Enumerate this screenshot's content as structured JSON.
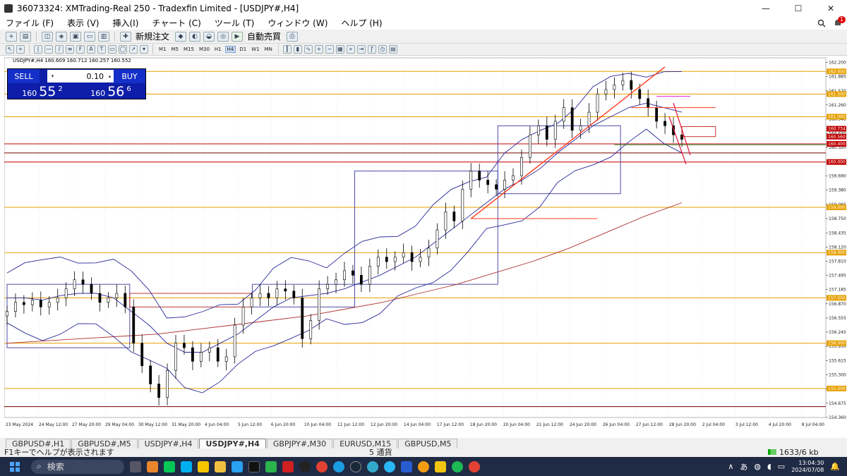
{
  "window": {
    "title": "36073324: XMTrading-Real 250 - Tradexfin Limited - [USDJPY#,H4]",
    "minimize": "—",
    "maximize": "☐",
    "close": "✕"
  },
  "menu": {
    "items": [
      "ファイル (F)",
      "表示 (V)",
      "挿入(I)",
      "チャート (C)",
      "ツール (T)",
      "ウィンドウ (W)",
      "ヘルプ (H)"
    ],
    "notification_count": "1"
  },
  "toolbar1": {
    "new_order": "新規注文",
    "auto_trade": "自動売買"
  },
  "toolbar2": {
    "timeframes": [
      "M1",
      "M5",
      "M15",
      "M30",
      "H1",
      "H4",
      "D1",
      "W1",
      "MN"
    ],
    "active_timeframe": "H4"
  },
  "chart_header": {
    "symbol_info": "USDJPY#,H4  160.609 160.712 160.257 160.552"
  },
  "trade_panel": {
    "sell_label": "SELL",
    "buy_label": "BUY",
    "lot": "0.10",
    "sell_big": "160",
    "sell_mid": "55",
    "sell_small": "2",
    "buy_big": "160",
    "buy_mid": "56",
    "buy_small": "6"
  },
  "chart_data": {
    "type": "candlestick",
    "symbol": "USDJPY#",
    "timeframe": "H4",
    "ylim": [
      154.36,
      162.3
    ],
    "y_ticks": [
      "162.200",
      "161.885",
      "161.570",
      "161.260",
      "160.945",
      "160.630",
      "160.320",
      "159.690",
      "159.380",
      "159.065",
      "158.750",
      "158.435",
      "158.120",
      "157.810",
      "157.495",
      "157.185",
      "156.870",
      "156.555",
      "156.245",
      "155.930",
      "155.615",
      "155.300",
      "154.990",
      "154.675",
      "154.360"
    ],
    "x_ticks": [
      "23 May 2024",
      "24 May 12:00",
      "27 May 20:00",
      "29 May 04:00",
      "30 May 12:00",
      "31 May 20:00",
      "4 Jun 04:00",
      "5 Jun 12:00",
      "6 Jun 20:00",
      "10 Jun 04:00",
      "11 Jun 12:00",
      "12 Jun 20:00",
      "14 Jun 04:00",
      "17 Jun 12:00",
      "18 Jun 20:00",
      "20 Jun 04:00",
      "21 Jun 12:00",
      "24 Jun 20:00",
      "26 Jun 04:00",
      "27 Jun 12:00",
      "28 Jun 20:00",
      "2 Jul 04:00",
      "3 Jul 12:00",
      "4 Jul 20:00",
      "8 Jul 04:00"
    ],
    "price_labels": [
      {
        "value": 162.0,
        "text": "162.000",
        "color": "#e6a000"
      },
      {
        "value": 161.5,
        "text": "161.500",
        "color": "#e6a000"
      },
      {
        "value": 161.0,
        "text": "161.000",
        "color": "#e6a000"
      },
      {
        "value": 160.734,
        "text": "160.734",
        "color": "#c00000"
      },
      {
        "value": 160.56,
        "text": "160.560",
        "color": "#c00000"
      },
      {
        "value": 160.4,
        "text": "160.400",
        "color": "#c00000"
      },
      {
        "value": 160.0,
        "text": "160.000",
        "color": "#c00000"
      },
      {
        "value": 159.0,
        "text": "159.000",
        "color": "#e6a000"
      },
      {
        "value": 158.0,
        "text": "158.000",
        "color": "#e6a000"
      },
      {
        "value": 157.0,
        "text": "157.000",
        "color": "#e6a000"
      },
      {
        "value": 156.0,
        "text": "156.000",
        "color": "#e6a000"
      },
      {
        "value": 155.0,
        "text": "155.000",
        "color": "#e6a000"
      }
    ],
    "horizontal_levels": [
      {
        "value": 162.0,
        "color": "#e6a000"
      },
      {
        "value": 161.5,
        "color": "#e6a000"
      },
      {
        "value": 161.0,
        "color": "#e6a000"
      },
      {
        "value": 160.4,
        "color": "#c00000"
      },
      {
        "value": 160.2,
        "color": "#7a0000"
      },
      {
        "value": 160.0,
        "color": "#c00000"
      },
      {
        "value": 159.0,
        "color": "#e6a000"
      },
      {
        "value": 158.0,
        "color": "#e6a000"
      },
      {
        "value": 157.0,
        "color": "#e6a000"
      },
      {
        "value": 156.0,
        "color": "#e6a000"
      },
      {
        "value": 155.0,
        "color": "#e6a000"
      },
      {
        "value": 154.6,
        "color": "#7a0000"
      }
    ],
    "close_path": [
      156.7,
      156.9,
      156.85,
      156.95,
      156.8,
      156.9,
      157.0,
      157.2,
      157.4,
      157.3,
      157.1,
      156.9,
      157.0,
      157.1,
      156.8,
      156.0,
      155.5,
      155.1,
      154.8,
      155.4,
      156.0,
      155.9,
      155.6,
      155.8,
      155.9,
      155.6,
      155.7,
      156.4,
      156.8,
      157.0,
      157.1,
      157.0,
      157.2,
      157.15,
      157.0,
      156.1,
      156.5,
      157.2,
      157.3,
      157.4,
      157.6,
      157.5,
      157.3,
      157.7,
      157.9,
      157.8,
      157.9,
      158.0,
      157.8,
      157.9,
      158.1,
      158.5,
      158.9,
      158.7,
      159.4,
      159.8,
      159.6,
      159.5,
      159.4,
      159.6,
      159.7,
      160.1,
      160.6,
      160.8,
      160.5,
      160.9,
      161.2,
      160.7,
      160.8,
      161.1,
      161.5,
      161.6,
      161.7,
      161.8,
      161.6,
      161.4,
      161.2,
      160.9,
      160.8,
      160.6,
      160.5
    ],
    "bollinger_center": [
      157.0,
      157.0,
      156.95,
      157.05,
      157.1,
      157.1,
      157.0,
      156.7,
      156.4,
      156.0,
      155.8,
      155.8,
      156.0,
      156.2,
      156.5,
      156.8,
      157.0,
      157.05,
      157.1,
      157.2,
      157.35,
      157.5,
      157.7,
      157.9,
      158.2,
      158.5,
      158.8,
      159.1,
      159.4,
      159.6,
      159.85,
      160.2,
      160.5,
      160.8,
      161.0,
      161.2,
      161.3,
      161.2,
      161.1
    ],
    "ma_long": [
      156.0,
      156.05,
      156.1,
      156.15,
      156.2,
      156.3,
      156.4,
      156.5,
      156.6,
      156.75,
      156.9,
      157.1,
      157.3,
      157.55,
      157.8,
      158.1,
      158.45,
      158.8,
      159.1
    ],
    "range_boxes": [
      {
        "from_index": 0,
        "to_index": 6,
        "low": 155.9,
        "high": 157.3,
        "color": "#3a3aa0"
      },
      {
        "from_index": 6,
        "to_index": 12,
        "low": 156.8,
        "high": 157.1,
        "color": "#b22222"
      },
      {
        "from_index": 12,
        "to_index": 17,
        "low": 156.8,
        "high": 157.3,
        "color": "#3a3aa0"
      },
      {
        "from_index": 17,
        "to_index": 24,
        "low": 157.3,
        "high": 159.8,
        "color": "#3a3aa0"
      },
      {
        "from_index": 24,
        "to_index": 30,
        "low": 159.3,
        "high": 160.8,
        "color": "#3a3aa0"
      }
    ]
  },
  "tabs": {
    "items": [
      "GBPUSD#,H1",
      "GBPUSD#,M5",
      "USDJPY#,H4",
      "USDJPY#,H4",
      "GBPJPY#,M30",
      "EURUSD,M15",
      "GBPUSD,M5"
    ],
    "active_index": 3
  },
  "status": {
    "help": "F1キーでヘルプが表示されます",
    "mid": "5 通貨",
    "traffic": "1633/6 kb"
  },
  "taskbar": {
    "search": "検索",
    "ime": "あ",
    "time": "13:04:30",
    "date": "2024/07/08"
  },
  "colors": {
    "candle": "#000000",
    "bollinger": "#2a2a9a",
    "ma": "#b03030",
    "trendline": "#ff3b1f",
    "fib": "#e6a000"
  }
}
